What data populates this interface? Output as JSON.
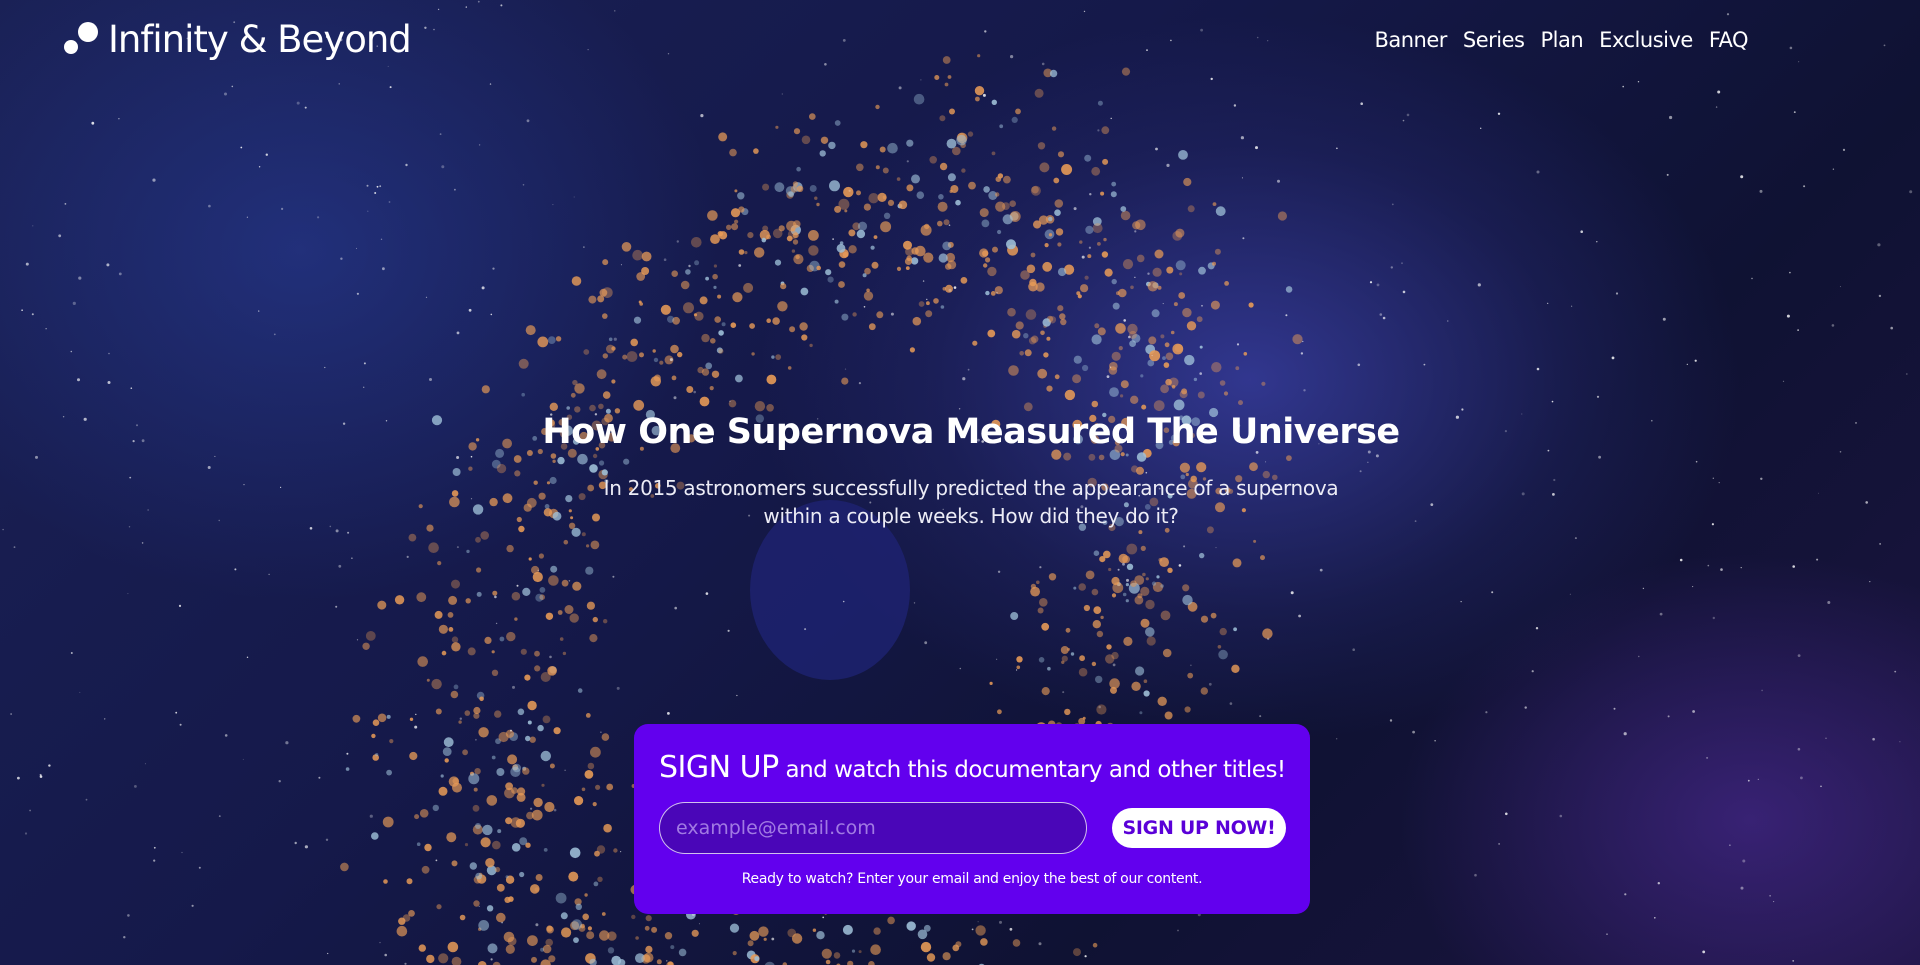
{
  "brand": {
    "name": "Infinity & Beyond"
  },
  "nav": {
    "items": [
      {
        "label": "Banner"
      },
      {
        "label": "Series"
      },
      {
        "label": "Plan"
      },
      {
        "label": "Exclusive"
      },
      {
        "label": "FAQ"
      }
    ]
  },
  "hero": {
    "title": "How One Supernova Measured The Universe",
    "subtitle": "In 2015 astronomers successfully predicted the appearance of a supernova within a couple weeks. How did they do it?"
  },
  "signup": {
    "heading_big": "SIGN UP",
    "heading_rest": " and watch this documentary and other titles!",
    "email_placeholder": "example@email.com",
    "button_label": "SIGN UP NOW!",
    "note": "Ready to watch? Enter your email and enjoy the best of our content."
  },
  "colors": {
    "card_accent": "#6200ee",
    "button_text": "#5a00d8",
    "background": "#141a3c"
  }
}
